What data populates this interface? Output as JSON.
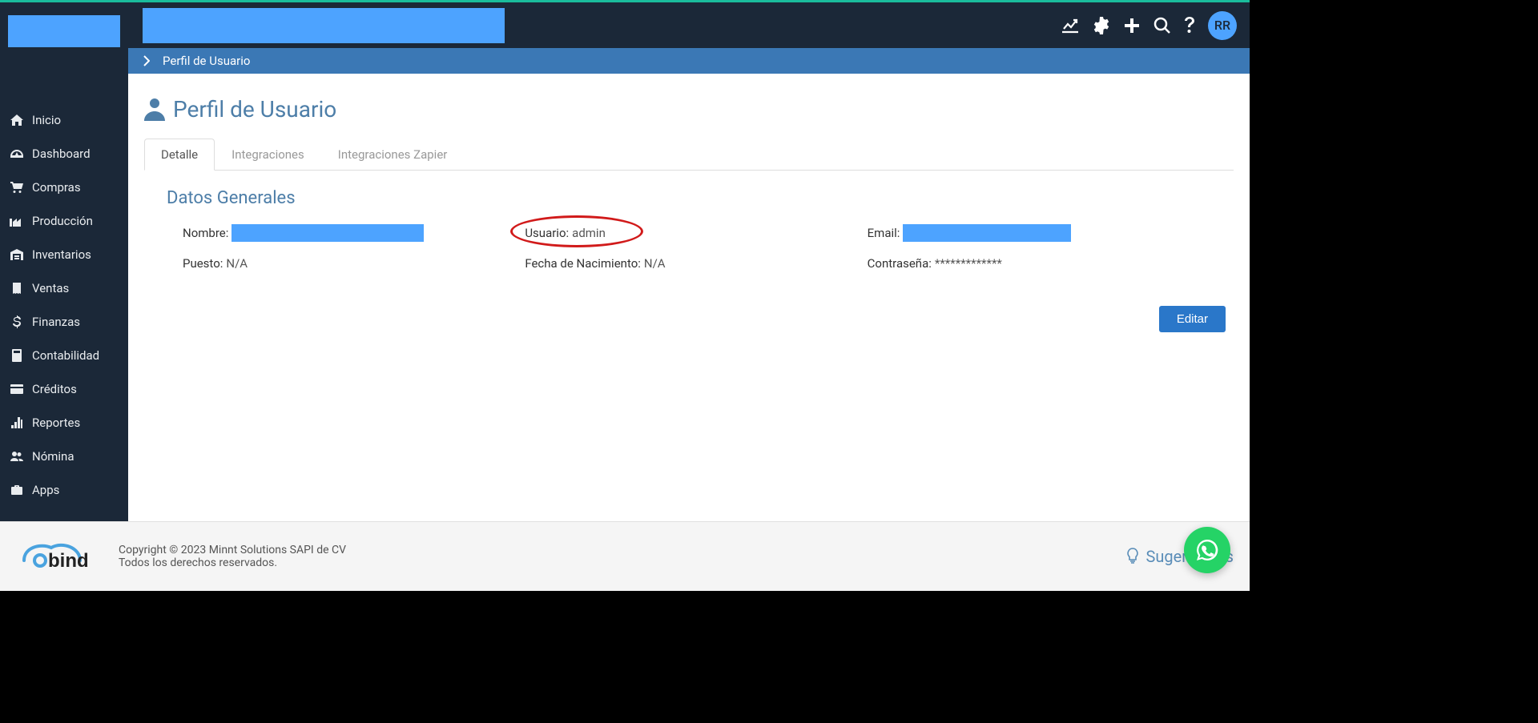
{
  "sidebar": {
    "items": [
      {
        "label": "Inicio",
        "icon": "home"
      },
      {
        "label": "Dashboard",
        "icon": "gauge"
      },
      {
        "label": "Compras",
        "icon": "cart"
      },
      {
        "label": "Producción",
        "icon": "factory"
      },
      {
        "label": "Inventarios",
        "icon": "warehouse"
      },
      {
        "label": "Ventas",
        "icon": "receipt"
      },
      {
        "label": "Finanzas",
        "icon": "dollar"
      },
      {
        "label": "Contabilidad",
        "icon": "calculator"
      },
      {
        "label": "Créditos",
        "icon": "card"
      },
      {
        "label": "Reportes",
        "icon": "bars"
      },
      {
        "label": "Nómina",
        "icon": "users"
      },
      {
        "label": "Apps",
        "icon": "briefcase"
      }
    ]
  },
  "header": {
    "avatar_initials": "RR"
  },
  "breadcrumb": {
    "title": "Perfil de Usuario"
  },
  "page": {
    "title": "Perfil de Usuario",
    "tabs": [
      {
        "label": "Detalle",
        "active": true
      },
      {
        "label": "Integraciones",
        "active": false
      },
      {
        "label": "Integraciones Zapier",
        "active": false
      }
    ],
    "section_title": "Datos Generales",
    "fields": {
      "nombre_label": "Nombre:",
      "usuario_label": "Usuario:",
      "usuario_value": "admin",
      "email_label": "Email:",
      "puesto_label": "Puesto:",
      "puesto_value": "N/A",
      "fecha_label": "Fecha de Nacimiento:",
      "fecha_value": "N/A",
      "contrasena_label": "Contraseña:",
      "contrasena_value": "*************"
    },
    "edit_button": "Editar"
  },
  "footer": {
    "copyright_line1": "Copyright © 2023 Minnt Solutions SAPI de CV",
    "copyright_line2": "Todos los derechos reservados.",
    "suggestions_label": "Sugerencias"
  }
}
